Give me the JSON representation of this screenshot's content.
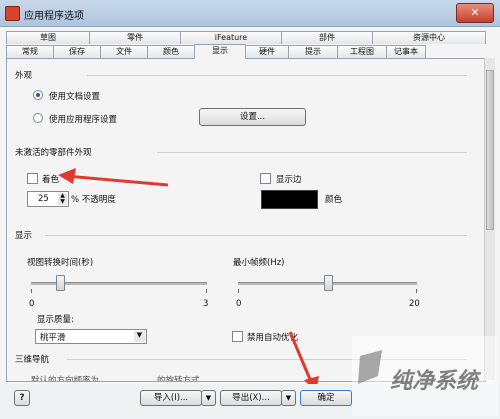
{
  "window": {
    "title": "应用程序选项",
    "close_glyph": "✕"
  },
  "tabs_back": [
    "草图",
    "零件",
    "iFeature",
    "部件",
    "资源中心"
  ],
  "tabs_front": [
    "常规",
    "保存",
    "文件",
    "颜色",
    "显示",
    "硬件",
    "提示",
    "工程图",
    "记事本"
  ],
  "appearance": {
    "label": "外观",
    "use_doc_settings": "使用文档设置",
    "use_app_settings": "使用应用程序设置",
    "settings_button": "设置..."
  },
  "inactive": {
    "label": "未激活的零部件外观",
    "shading": "着色",
    "display_edges": "显示边",
    "opacity_value": "25",
    "opacity_label": "% 不透明度",
    "color_label": "颜色",
    "color_swatch": "#000000"
  },
  "display": {
    "label": "显示",
    "view_transition": "视图转换时间(秒)",
    "min_framerate": "最小帧频(Hz)",
    "view_transition_value": 0.5,
    "min_framerate_value": 10,
    "slider1_min": "0",
    "slider1_max": "3",
    "slider2_min": "0",
    "slider2_max": "20",
    "quality_label": "显示质量:",
    "quality_value": "桃平滑",
    "disable_auto_refine": "禁用自动优化"
  },
  "navigation": {
    "label": "三维导航",
    "partial_1": "默认的方向频率为",
    "partial_2": "的旋转方式"
  },
  "bottom": {
    "help": "?",
    "import": "导入(I)...",
    "export": "导出(X)...",
    "ok": "确定"
  },
  "colors": {
    "annotation_red": "#e03a2f",
    "accent_blue": "#2a55a8"
  },
  "watermark": "纯净系统"
}
